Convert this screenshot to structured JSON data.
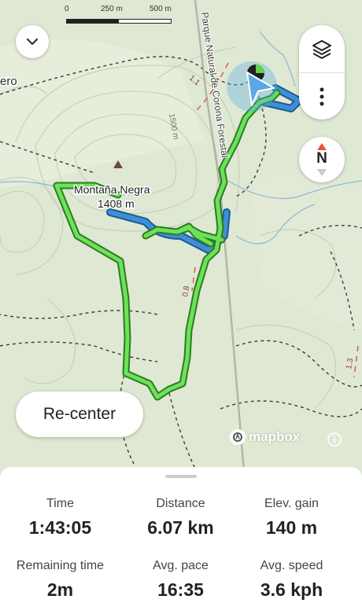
{
  "map": {
    "scale_labels": [
      "0",
      "250 m",
      "500 m"
    ],
    "peak_name": "Montaña Negra",
    "peak_elevation": "1408 m",
    "park_label": "Parque Natural de Corona Forestal",
    "contour_label": "1500 m",
    "road_label_1": "1.1",
    "road_label_2": "0.8",
    "road_label_3": "1.3",
    "place_label": "ero",
    "compass_label": "N",
    "colors": {
      "track": "#5fd14a",
      "track_edge": "#2a7d22",
      "water": "#2f7ec0",
      "location": "#5aa9e6"
    }
  },
  "controls": {
    "collapse_icon": "chevron-down-icon",
    "layers_icon": "layers-icon",
    "more_icon": "more-vertical-icon",
    "recenter_label": "Re-center",
    "attribution": "mapbox"
  },
  "stats": [
    {
      "title": "Time",
      "value": "1:43:05"
    },
    {
      "title": "Distance",
      "value": "6.07 km"
    },
    {
      "title": "Elev. gain",
      "value": "140 m"
    },
    {
      "title": "Remaining time",
      "value": "2m"
    },
    {
      "title": "Avg. pace",
      "value": "16:35"
    },
    {
      "title": "Avg. speed",
      "value": "3.6 kph"
    }
  ]
}
